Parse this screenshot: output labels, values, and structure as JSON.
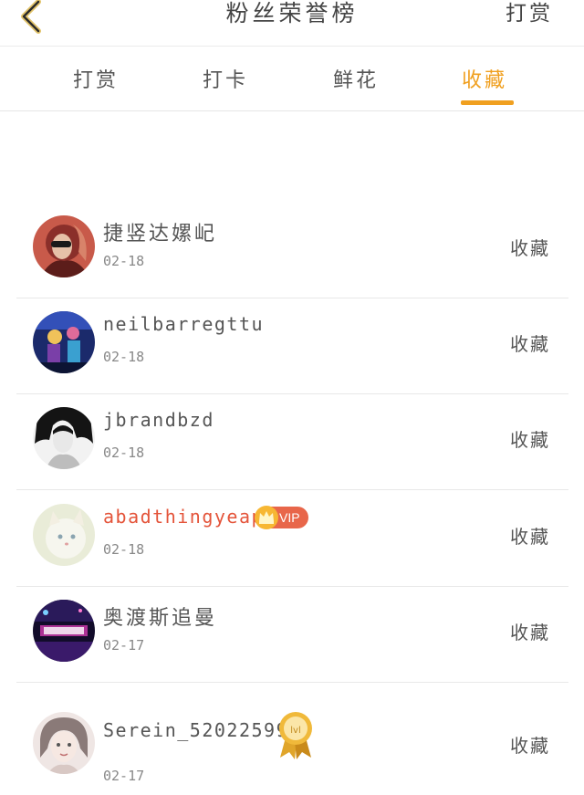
{
  "header": {
    "title": "粉丝荣誉榜",
    "right_action": "打赏",
    "back_icon": "chevron-left-icon",
    "accent_color": "#f0a020"
  },
  "tabs": [
    {
      "label": "打赏",
      "active": false
    },
    {
      "label": "打卡",
      "active": false
    },
    {
      "label": "鲜花",
      "active": false
    },
    {
      "label": "收藏",
      "active": true
    }
  ],
  "rows": [
    {
      "name": "捷竖达嫘屺",
      "date": "02-18",
      "action": "收藏"
    },
    {
      "name": "neilbarregttu",
      "date": "02-18",
      "action": "收藏"
    },
    {
      "name": "jbrandbzd",
      "date": "02-18",
      "action": "收藏"
    },
    {
      "name": "abadthingyeape",
      "date": "02-18",
      "action": "收藏",
      "badge": "VIP"
    },
    {
      "name": "奥渡斯追曼",
      "date": "02-17",
      "action": "收藏"
    },
    {
      "name": "Serein_520225992",
      "date": "02-17",
      "action": "收藏",
      "medal_text": "lvl"
    }
  ]
}
